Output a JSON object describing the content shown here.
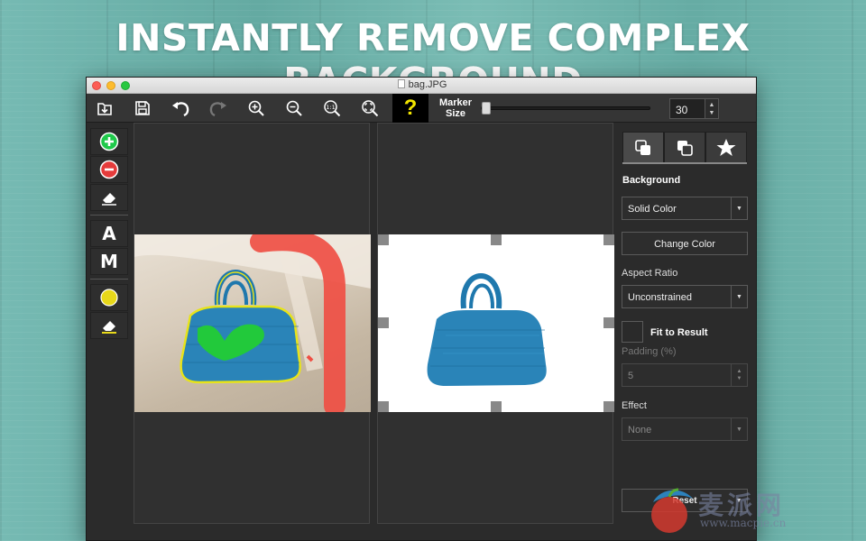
{
  "headline": "INSTANTLY REMOVE COMPLEX BACKGROUND",
  "window": {
    "title": "bag.JPG"
  },
  "toolbar": {
    "buttons": [
      {
        "name": "import-button",
        "icon": "import-icon"
      },
      {
        "name": "save-button",
        "icon": "save-icon"
      },
      {
        "name": "undo-button",
        "icon": "undo-icon"
      },
      {
        "name": "redo-button",
        "icon": "redo-icon"
      },
      {
        "name": "zoom-in-button",
        "icon": "zoom-in-icon"
      },
      {
        "name": "zoom-out-button",
        "icon": "zoom-out-icon"
      },
      {
        "name": "actual-size-button",
        "icon": "actual-size-icon"
      },
      {
        "name": "fit-screen-button",
        "icon": "fit-screen-icon"
      }
    ],
    "help_label": "?",
    "marker_label": "Marker Size",
    "marker_value": "30",
    "marker_fraction": 0.0
  },
  "tools": {
    "add_icon": "plus-circle-icon",
    "remove_icon": "minus-circle-icon",
    "eraser_icon": "eraser-icon",
    "auto_label": "A",
    "manual_label": "M",
    "color_icon": "yellow-dot-icon"
  },
  "panel": {
    "background_heading": "Background",
    "background_value": "Solid Color",
    "change_color_label": "Change Color",
    "aspect_ratio_label": "Aspect Ratio",
    "aspect_ratio_value": "Unconstrained",
    "fit_to_result_label": "Fit to Result",
    "padding_label": "Padding (%)",
    "padding_value": "5",
    "effect_label": "Effect",
    "effect_value": "None",
    "reset_label": "Reset"
  },
  "watermark": {
    "text": "麦派网",
    "url": "www.macpie.cn"
  },
  "colors": {
    "accent_green": "#1fc94a",
    "accent_red": "#e53b3b",
    "help_yellow": "#f3e600",
    "bag_blue": "#2a84b8"
  }
}
